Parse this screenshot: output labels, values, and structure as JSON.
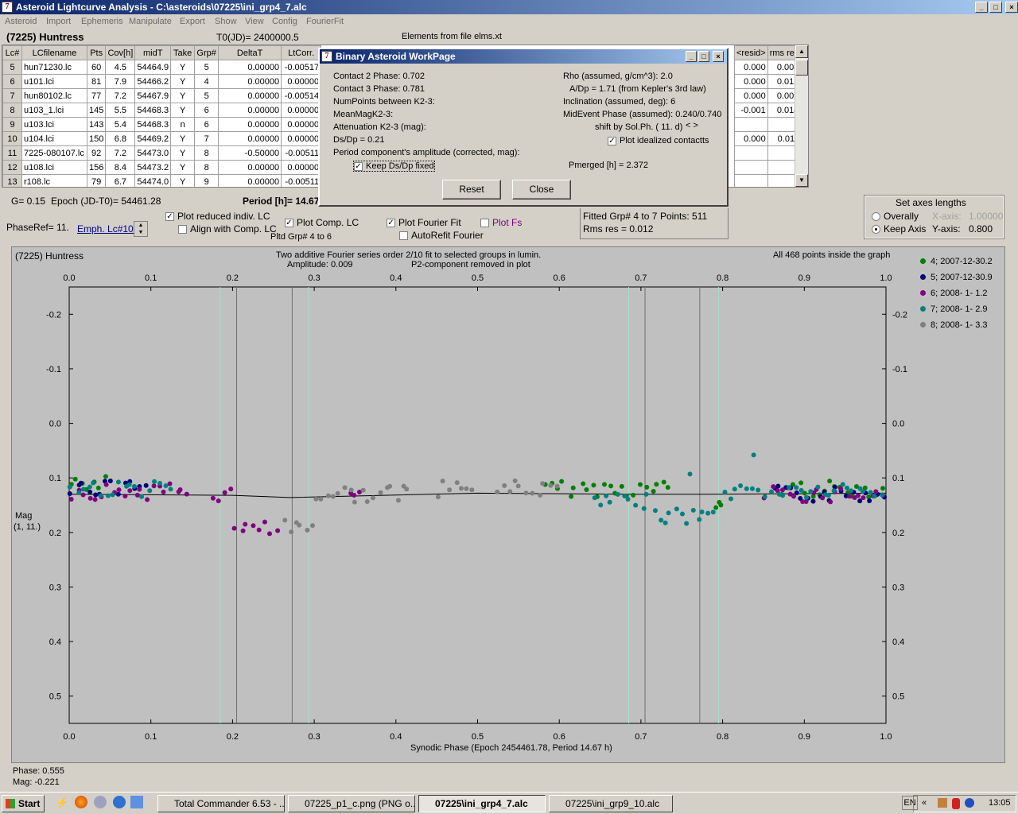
{
  "window": {
    "title": "Asteroid Lightcurve Analysis - C:\\asteroids\\07225\\ini_grp4_7.alc",
    "min": "_",
    "max": "□",
    "close": "×"
  },
  "menu": [
    "Asteroid",
    "Import",
    "Ephemeris",
    "Manipulate",
    "Export",
    "Show",
    "View",
    "Config",
    "FourierFit"
  ],
  "header": {
    "object": "(7225) Huntress",
    "t0": "T0(JD)= 2400000.5",
    "elements": "Elements from file elms.xt"
  },
  "table": {
    "columns": [
      "Lc#",
      "LCfilename",
      "Pts",
      "Cov[h]",
      "midT",
      "Take",
      "Grp#",
      "DeltaT",
      "LtCorr."
    ],
    "rows": [
      [
        "5",
        "hun71230.lc",
        "60",
        "4.5",
        "54464.9",
        "Y",
        "5",
        "0.00000",
        "-0.00517"
      ],
      [
        "6",
        "u101.lci",
        "81",
        "7.9",
        "54466.2",
        "Y",
        "4",
        "0.00000",
        "0.00000"
      ],
      [
        "7",
        "hun80102.lc",
        "77",
        "7.2",
        "54467.9",
        "Y",
        "5",
        "0.00000",
        "-0.00514"
      ],
      [
        "8",
        "u103_1.lci",
        "145",
        "5.5",
        "54468.3",
        "Y",
        "6",
        "0.00000",
        "0.00000"
      ],
      [
        "9",
        "u103.lci",
        "143",
        "5.4",
        "54468.3",
        "n",
        "6",
        "0.00000",
        "0.00000"
      ],
      [
        "10",
        "u104.lci",
        "150",
        "6.8",
        "54469.2",
        "Y",
        "7",
        "0.00000",
        "0.00000"
      ],
      [
        "11",
        "7225-080107.lc",
        "92",
        "7.2",
        "54473.0",
        "Y",
        "8",
        "-0.50000",
        "-0.00511"
      ],
      [
        "12",
        "u108.lci",
        "156",
        "8.4",
        "54473.2",
        "Y",
        "8",
        "0.00000",
        "0.00000"
      ],
      [
        "13",
        "r108.lc",
        "79",
        "6.7",
        "54474.0",
        "Y",
        "9",
        "0.00000",
        "-0.00511"
      ]
    ],
    "right_columns": [
      "<resid>",
      "rms res"
    ],
    "right_rows": [
      [
        "0.000",
        "0.008"
      ],
      [
        "0.000",
        "0.012"
      ],
      [
        "0.000",
        "0.009"
      ],
      [
        "-0.001",
        "0.014"
      ],
      [
        "",
        ""
      ],
      [
        "0.000",
        "0.011"
      ],
      [
        "",
        ""
      ],
      [
        "",
        ""
      ],
      [
        "",
        ""
      ]
    ]
  },
  "info": {
    "g": "G= 0.15",
    "epoch": "Epoch (JD-T0)= 54461.28",
    "period": "Period [h]= 14.67",
    "phaseref": "PhaseRef= 11.",
    "emph": "Emph. Lc#10:"
  },
  "options": {
    "plot_reduced": "Plot reduced indiv. LC",
    "align_comp": "Align with Comp. LC",
    "plot_comp": "Plot Comp. LC",
    "pltd_grp": "Pltd Grp#  4  to    6",
    "plot_fourier": "Plot Fourier Fit",
    "autorefit": "AutoRefit Fourier",
    "plot_fs": "Plot Fs"
  },
  "fitinfo": {
    "fitted": "Fitted Grp# 4 to 7",
    "points": "Points: 511",
    "rms": "Rms res      = 0.012"
  },
  "axes_panel": {
    "title": "Set axes lengths",
    "overally": "Overally",
    "keep": "Keep Axis",
    "xaxis_label": "X-axis:",
    "xaxis_val": "1.00000",
    "yaxis_label": "Y-axis:",
    "yaxis_val": "0.800"
  },
  "dialog": {
    "title": "Binary Asteroid WorkPage",
    "left": [
      "Contact 2 Phase:   0.702",
      "Contact 3 Phase:   0.781",
      "NumPoints between K2-3:",
      "MeanMagK2-3:",
      "Attenuation K2-3 (mag):",
      "Ds/Dp = 0.21",
      "Period component's amplitude (corrected, mag):"
    ],
    "keep": "Keep Ds/Dp fixed",
    "right": [
      "Rho (assumed, g/cm^3): 2.0",
      "A/Dp = 1.71 (from Kepler's 3rd law)",
      "Inclination (assumed, deg): 6",
      "MidEvent Phase (assumed): 0.240/0.740",
      "shift by Sol.Ph. ( 11. d)"
    ],
    "arrows": "< >",
    "plot_ideal": "Plot idealized contactts",
    "pmerged": "Pmerged [h] =  2.372",
    "reset": "Reset",
    "close": "Close"
  },
  "plot": {
    "name": "(7225) Huntress",
    "title1": "Two additive Fourier series order 2/10 fit to selected groups in lumin.",
    "title2": "Amplitude: 0.009",
    "title3": "P2-component removed in plot",
    "inside": "All 468 points inside the graph",
    "ylabel1": "Mag",
    "ylabel2": "(1, 11.)",
    "xlabel": "Synodic Phase (Epoch 2454461.78, Period 14.67 h)"
  },
  "chart_data": {
    "type": "scatter",
    "xlim": [
      0,
      1
    ],
    "ylim": [
      0.55,
      -0.25
    ],
    "xticks": [
      "0.0",
      "0.1",
      "0.2",
      "0.3",
      "0.4",
      "0.5",
      "0.6",
      "0.7",
      "0.8",
      "0.9",
      "1.0"
    ],
    "yticks": [
      "-0.2",
      "-0.1",
      "0.0",
      "0.1",
      "0.2",
      "0.3",
      "0.4",
      "0.5"
    ],
    "vlines_dark": [
      0.205,
      0.273,
      0.705,
      0.772
    ],
    "vlines_light": [
      0.185,
      0.293,
      0.685,
      0.795
    ],
    "series": [
      {
        "name": "4; 2007-12-30.2",
        "color": "#008000",
        "segments": [
          [
            0.0,
            0.048,
            0.11
          ],
          [
            0.58,
            0.74,
            0.12
          ],
          [
            0.79,
            0.8,
            0.15
          ],
          [
            0.87,
            1.0,
            0.12
          ]
        ]
      },
      {
        "name": "5; 2007-12-30.9",
        "color": "#00007a",
        "segments": [
          [
            0.0,
            0.1,
            0.12
          ],
          [
            0.86,
            1.0,
            0.13
          ]
        ]
      },
      {
        "name": "6; 2008- 1- 1.2",
        "color": "#800080",
        "segments": [
          [
            0.0,
            0.15,
            0.125
          ],
          [
            0.175,
            0.2,
            0.13
          ],
          [
            0.2,
            0.26,
            0.195
          ],
          [
            0.34,
            0.36,
            0.14
          ],
          [
            0.85,
            1.0,
            0.13
          ]
        ]
      },
      {
        "name": "7; 2008- 1- 2.9",
        "color": "#008080",
        "segments": [
          [
            0.0,
            0.13,
            0.12
          ],
          [
            0.64,
            0.72,
            0.145
          ],
          [
            0.72,
            0.795,
            0.17
          ],
          [
            0.8,
            1.0,
            0.125
          ]
        ]
      },
      {
        "name": "8; 2008- 1- 3.3",
        "color": "#808080",
        "segments": [
          [
            0.26,
            0.3,
            0.19
          ],
          [
            0.3,
            0.42,
            0.13
          ],
          [
            0.45,
            0.5,
            0.12
          ],
          [
            0.52,
            0.6,
            0.12
          ]
        ]
      }
    ],
    "fit_line": [
      [
        0,
        0.13
      ],
      [
        0.2,
        0.132
      ],
      [
        0.27,
        0.136
      ],
      [
        0.5,
        0.128
      ],
      [
        0.7,
        0.13
      ],
      [
        0.78,
        0.13
      ],
      [
        1.0,
        0.128
      ]
    ],
    "outliers": [
      [
        0.838,
        0.058
      ],
      [
        0.76,
        0.093
      ]
    ]
  },
  "status": {
    "phase": "Phase:  0.555",
    "mag": "Mag:   -0.221"
  },
  "taskbar": {
    "start": "Start",
    "items": [
      "Total Commander 6.53 - ...",
      "07225_p1_c.png (PNG o...",
      "07225\\ini_grp4_7.alc",
      "07225\\ini_grp9_10.alc"
    ],
    "lang": "EN",
    "clock": "13:05"
  }
}
